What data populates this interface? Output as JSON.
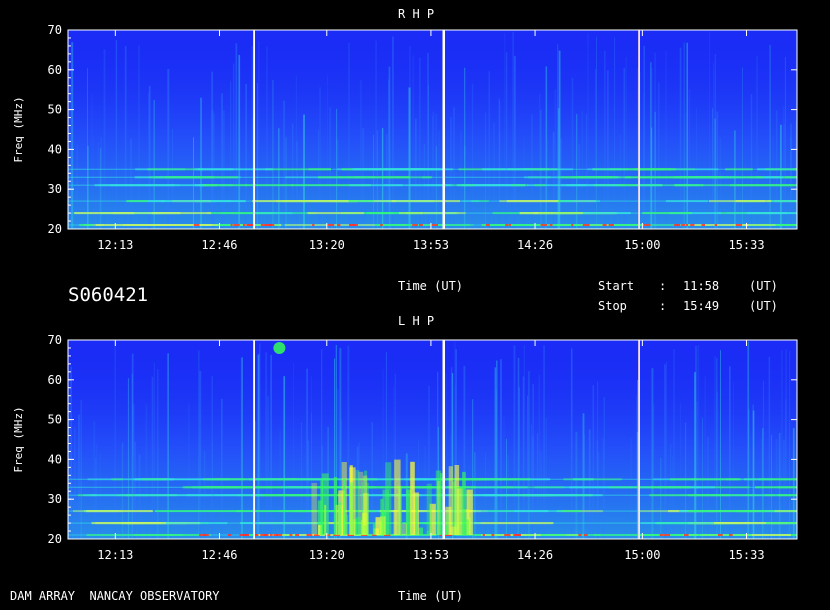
{
  "header": {
    "panel_top_title": "R H P",
    "panel_bottom_title": "L H P",
    "observation_id": "S060421",
    "time_label": "Time (UT)",
    "start_label": "Start",
    "start_sep": ":",
    "start_value": "11:58",
    "start_unit": "(UT)",
    "stop_label": "Stop",
    "stop_sep": ":",
    "stop_value": "15:49",
    "stop_unit": "(UT)",
    "footer_left": "DAM ARRAY  NANCAY OBSERVATORY",
    "footer_time_label": "Time (UT)"
  },
  "colors": {
    "background": "#000000",
    "low": "#1a2cf5",
    "mid": "#2f7bff",
    "cyan": "#33e0e0",
    "green": "#33ff55",
    "yellow": "#ffff33",
    "red": "#ff3030",
    "frame": "#ffffff"
  },
  "chart_data": [
    {
      "type": "heatmap",
      "title": "R H P",
      "xlabel": "Time (UT)",
      "ylabel": "Freq (MHz)",
      "xlim": [
        "11:58",
        "15:49"
      ],
      "ylim": [
        20,
        70
      ],
      "x_ticks": [
        "12:13",
        "12:46",
        "13:20",
        "13:53",
        "14:26",
        "15:00",
        "15:33"
      ],
      "y_ticks": [
        20,
        30,
        40,
        50,
        60,
        70
      ],
      "vertical_markers": [
        "12:57",
        "13:57",
        "14:59"
      ],
      "emission_bands_mhz": [
        21,
        24,
        27,
        31,
        33,
        35
      ]
    },
    {
      "type": "heatmap",
      "title": "L H P",
      "xlabel": "Time (UT)",
      "ylabel": "Freq (MHz)",
      "xlim": [
        "11:58",
        "15:49"
      ],
      "ylim": [
        20,
        70
      ],
      "x_ticks": [
        "12:13",
        "12:46",
        "13:20",
        "13:53",
        "14:26",
        "15:00",
        "15:33"
      ],
      "y_ticks": [
        20,
        30,
        40,
        50,
        60,
        70
      ],
      "vertical_markers": [
        "12:57",
        "13:57",
        "14:59"
      ],
      "emission_bands_mhz": [
        21,
        24,
        27,
        31,
        33,
        35
      ]
    }
  ]
}
